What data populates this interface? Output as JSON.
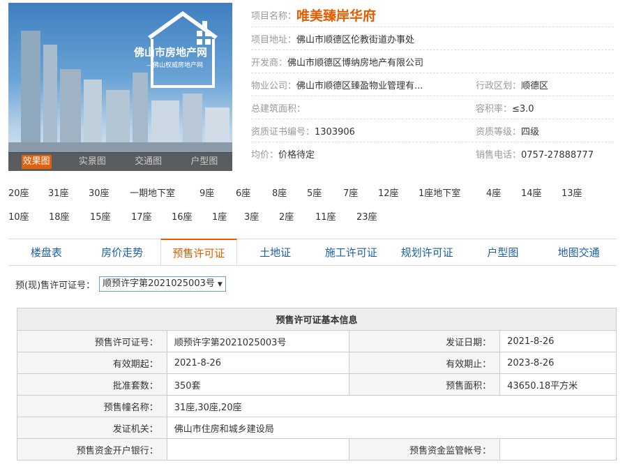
{
  "photo": {
    "watermark": "佛山市房地产网",
    "watermark_sub": "—佛山权威房地产网",
    "tabs": [
      "效果图",
      "实景图",
      "交通图",
      "户型图"
    ],
    "active_tab": 0
  },
  "project": {
    "name_label": "项目名称：",
    "name": "唯美臻岸华府",
    "address_label": "项目地址：",
    "address": "佛山市顺德区伦教街道办事处",
    "developer_label": "开发商：",
    "developer": "佛山市顺德区博纳房地产有限公司",
    "property_label": "物业公司：",
    "property": "佛山市顺德区臻盈物业管理有...",
    "district_label": "行政区划：",
    "district": "顺德区",
    "area_label": "总建筑面积：",
    "area": "",
    "far_label": "容积率：",
    "far": "≤3.0",
    "cert_label": "资质证书编号：",
    "cert": "1303906",
    "grade_label": "资质等级：",
    "grade": "四级",
    "price_label": "均价：",
    "price": "价格待定",
    "phone_label": "销售电话：",
    "phone": "0757-27888777"
  },
  "buildings_row1": [
    "20座",
    "31座",
    "30座",
    "一期地下室",
    "9座",
    "6座",
    "8座",
    "5座",
    "7座",
    "12座",
    "1座地下室",
    "4座",
    "14座",
    "13座"
  ],
  "buildings_row2": [
    "10座",
    "18座",
    "15座",
    "17座",
    "16座",
    "1座",
    "3座",
    "2座",
    "11座",
    "23座"
  ],
  "tabs": [
    "楼盘表",
    "房价走势",
    "预售许可证",
    "土地证",
    "施工许可证",
    "规划许可证",
    "户型图",
    "地图交通"
  ],
  "active_tab": 2,
  "permit_select": {
    "label": "预(现)售许可证号：",
    "value": "顺预许字第2021025003号"
  },
  "table": {
    "title": "预售许可证基本信息",
    "permit_no_label": "预售许可证号：",
    "permit_no": "顺预许字第2021025003号",
    "issue_date_label": "发证日期：",
    "issue_date": "2021-8-26",
    "valid_from_label": "有效期起：",
    "valid_from": "2021-8-26",
    "valid_to_label": "有效期止：",
    "valid_to": "2023-8-26",
    "units_label": "批准套数：",
    "units": "350套",
    "presale_area_label": "预售面积：",
    "presale_area": "43650.18平方米",
    "bldg_names_label": "预售幢名称：",
    "bldg_names": "31座,30座,20座",
    "authority_label": "发证机关：",
    "authority": "佛山市住房和城乡建设局",
    "bank_label": "预售资金开户银行：",
    "bank": "",
    "account_label": "预售资金监管帐号：",
    "account": ""
  }
}
